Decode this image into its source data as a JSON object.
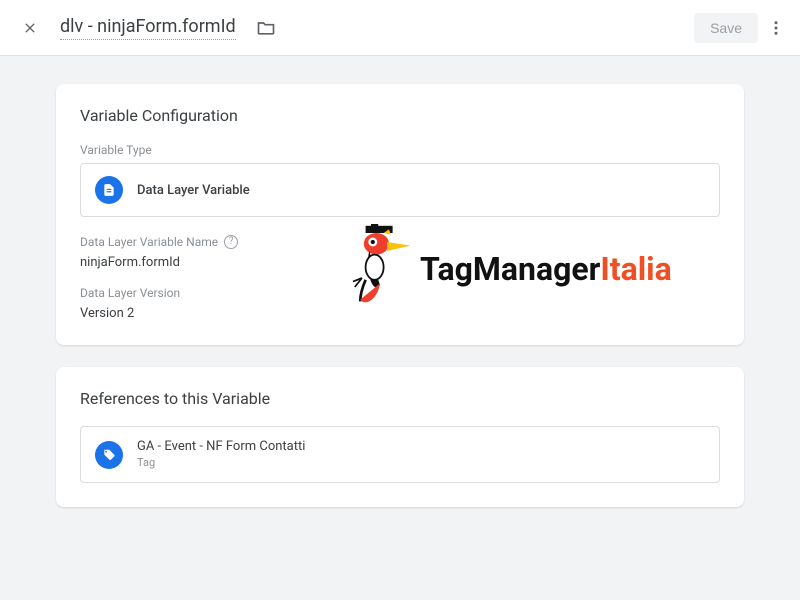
{
  "header": {
    "title": "dlv - ninjaForm.formId",
    "save_label": "Save"
  },
  "config": {
    "heading": "Variable Configuration",
    "type_label": "Variable Type",
    "type_value": "Data Layer Variable",
    "name_label": "Data Layer Variable Name",
    "name_value": "ninjaForm.formId",
    "version_label": "Data Layer Version",
    "version_value": "Version 2"
  },
  "refs": {
    "heading": "References to this Variable",
    "items": [
      {
        "title": "GA - Event - NF Form Contatti",
        "subtitle": "Tag"
      }
    ]
  },
  "watermark": {
    "brand_main": "TagManager",
    "brand_accent": "Italia"
  }
}
